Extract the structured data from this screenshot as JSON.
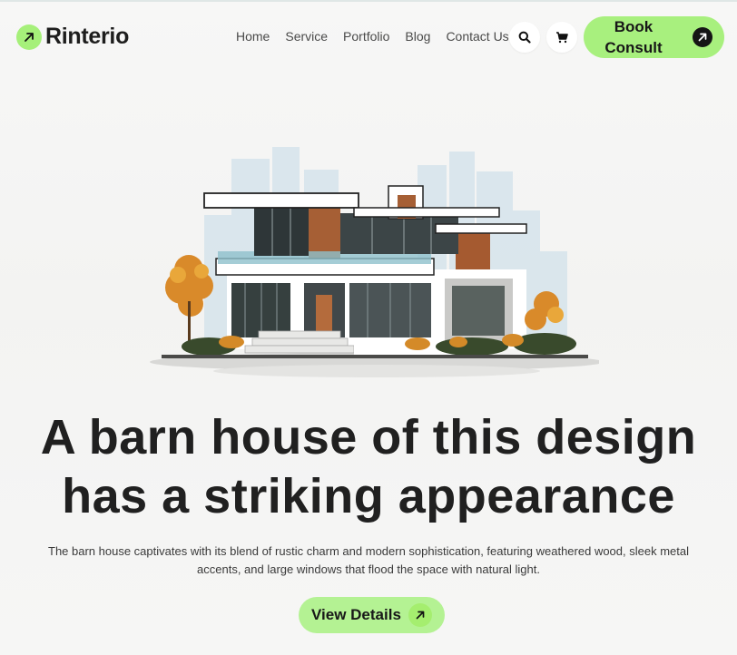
{
  "brand": {
    "name": "Rinterio",
    "accent_color": "#a6f07a",
    "logo_icon": "arrow-up-right-icon"
  },
  "nav": {
    "items": [
      "Home",
      "Service",
      "Portfolio",
      "Blog",
      "Contact Us"
    ],
    "search_icon": "search-icon",
    "cart_icon": "cart-icon"
  },
  "cta": {
    "book_line1": "Book",
    "book_line2": "Consult",
    "book_icon": "arrow-up-right-icon"
  },
  "hero": {
    "illustration": "modern-house-illustration",
    "headline_line1": "A barn house of this design",
    "headline_line2": "has a striking appearance",
    "description": "The barn house captivates with its blend of rustic charm and modern sophistication, featuring weathered wood, sleek metal accents, and large windows that flood the space with natural light.",
    "button_label": "View Details",
    "button_icon": "arrow-up-right-icon"
  }
}
